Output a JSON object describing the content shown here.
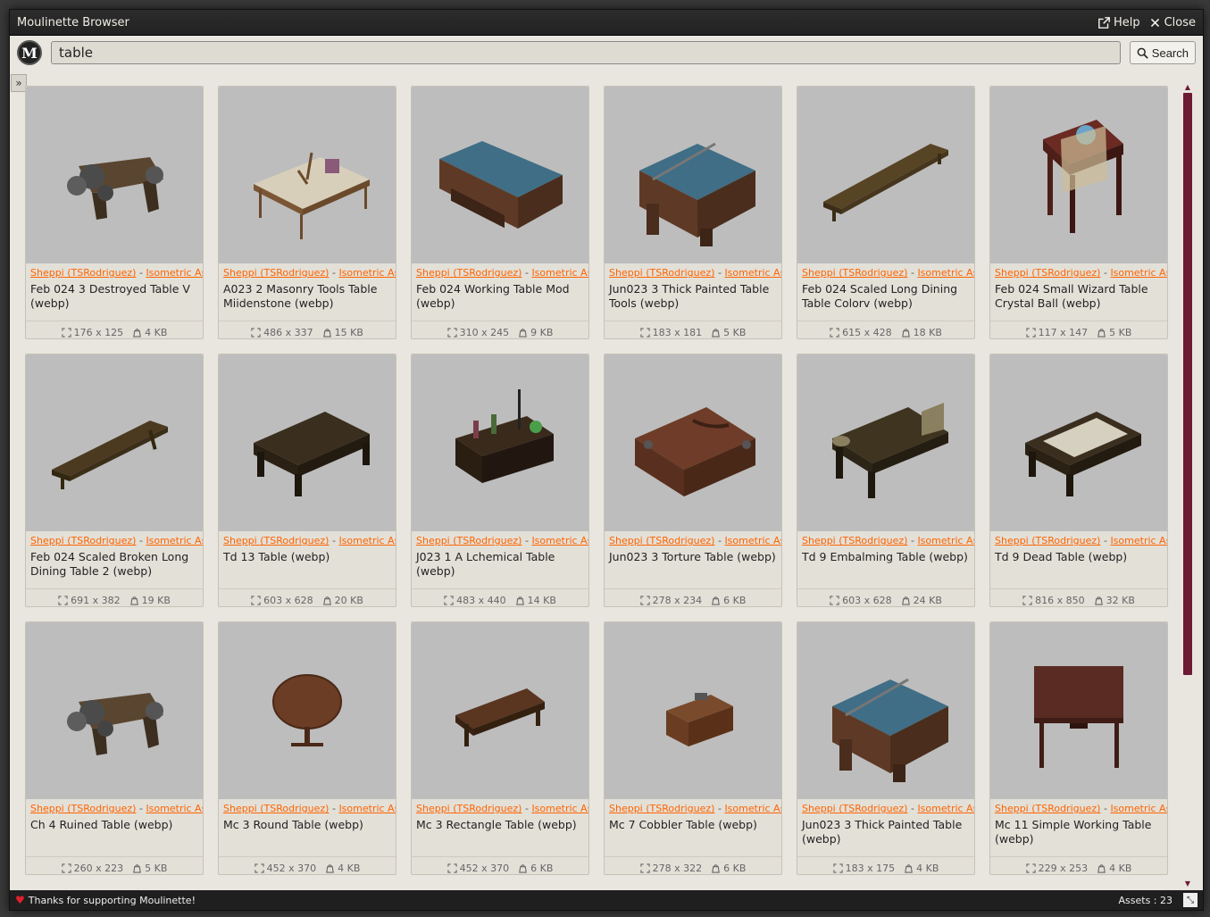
{
  "window": {
    "title": "Moulinette Browser",
    "help_label": "Help",
    "close_label": "Close"
  },
  "search": {
    "logo": "M",
    "value": "table",
    "button_label": "Search"
  },
  "expander_label": "»",
  "colors": {
    "accent": "#ff6400",
    "scrollbar": "#6d1a34",
    "thumb_bg": "#bdbdbd"
  },
  "assets": [
    {
      "creator": "Sheppi (TSRodriguez)",
      "pack": "Isometric Ass",
      "name": "Feb 024 3 Destroyed Table V (webp)",
      "dims": "176 x 125",
      "size": "4 KB",
      "icon": "destroyed-table"
    },
    {
      "creator": "Sheppi (TSRodriguez)",
      "pack": "Isometric Ass",
      "name": "A023 2 Masonry Tools Table Miidenstone (webp)",
      "dims": "486 x 337",
      "size": "15 KB",
      "icon": "tools-table"
    },
    {
      "creator": "Sheppi (TSRodriguez)",
      "pack": "Isometric Ass",
      "name": "Feb 024 Working Table Mod (webp)",
      "dims": "310 x 245",
      "size": "9 KB",
      "icon": "blue-table"
    },
    {
      "creator": "Sheppi (TSRodriguez)",
      "pack": "Isometric Ass",
      "name": "Jun023 3 Thick Painted Table Tools (webp)",
      "dims": "183 x 181",
      "size": "5 KB",
      "icon": "thick-blue-table"
    },
    {
      "creator": "Sheppi (TSRodriguez)",
      "pack": "Isometric Ass",
      "name": "Feb 024 Scaled Long Dining Table Colorv (webp)",
      "dims": "615 x 428",
      "size": "18 KB",
      "icon": "long-table"
    },
    {
      "creator": "Sheppi (TSRodriguez)",
      "pack": "Isometric Ass",
      "name": "Feb 024 Small Wizard Table Crystal Ball (webp)",
      "dims": "117 x 147",
      "size": "5 KB",
      "icon": "wizard-table"
    },
    {
      "creator": "Sheppi (TSRodriguez)",
      "pack": "Isometric Ass",
      "name": "Feb 024 Scaled Broken Long Dining Table 2 (webp)",
      "dims": "691 x 382",
      "size": "19 KB",
      "icon": "broken-long-table"
    },
    {
      "creator": "Sheppi (TSRodriguez)",
      "pack": "Isometric Ass",
      "name": "Td 13 Table (webp)",
      "dims": "603 x 628",
      "size": "20 KB",
      "icon": "dark-table"
    },
    {
      "creator": "Sheppi (TSRodriguez)",
      "pack": "Isometric Ass",
      "name": "J023 1 A Lchemical Table (webp)",
      "dims": "483 x 440",
      "size": "14 KB",
      "icon": "alchemy-table"
    },
    {
      "creator": "Sheppi (TSRodriguez)",
      "pack": "Isometric Ass",
      "name": "Jun023 3 Torture Table (webp)",
      "dims": "278 x 234",
      "size": "6 KB",
      "icon": "torture-table"
    },
    {
      "creator": "Sheppi (TSRodriguez)",
      "pack": "Isometric Ass",
      "name": "Td 9 Embalming Table (webp)",
      "dims": "603 x 628",
      "size": "24 KB",
      "icon": "embalming-table"
    },
    {
      "creator": "Sheppi (TSRodriguez)",
      "pack": "Isometric Ass",
      "name": "Td 9 Dead Table (webp)",
      "dims": "816 x 850",
      "size": "32 KB",
      "icon": "dead-table"
    },
    {
      "creator": "Sheppi (TSRodriguez)",
      "pack": "Isometric Ass",
      "name": "Ch 4 Ruined Table (webp)",
      "dims": "260 x 223",
      "size": "5 KB",
      "icon": "destroyed-table"
    },
    {
      "creator": "Sheppi (TSRodriguez)",
      "pack": "Isometric Ass",
      "name": "Mc 3 Round Table (webp)",
      "dims": "452 x 370",
      "size": "4 KB",
      "icon": "round-table"
    },
    {
      "creator": "Sheppi (TSRodriguez)",
      "pack": "Isometric Ass",
      "name": "Mc 3 Rectangle Table (webp)",
      "dims": "452 x 370",
      "size": "6 KB",
      "icon": "rect-table"
    },
    {
      "creator": "Sheppi (TSRodriguez)",
      "pack": "Isometric Ass",
      "name": "Mc 7 Cobbler Table (webp)",
      "dims": "278 x 322",
      "size": "6 KB",
      "icon": "cobbler-table"
    },
    {
      "creator": "Sheppi (TSRodriguez)",
      "pack": "Isometric Ass",
      "name": "Jun023 3 Thick Painted Table (webp)",
      "dims": "183 x 175",
      "size": "4 KB",
      "icon": "thick-blue-table"
    },
    {
      "creator": "Sheppi (TSRodriguez)",
      "pack": "Isometric Ass",
      "name": "Mc 11 Simple Working Table (webp)",
      "dims": "229 x 253",
      "size": "4 KB",
      "icon": "simple-table"
    }
  ],
  "status": {
    "message": "Thanks for supporting Moulinette!",
    "count": "Assets : 23"
  }
}
